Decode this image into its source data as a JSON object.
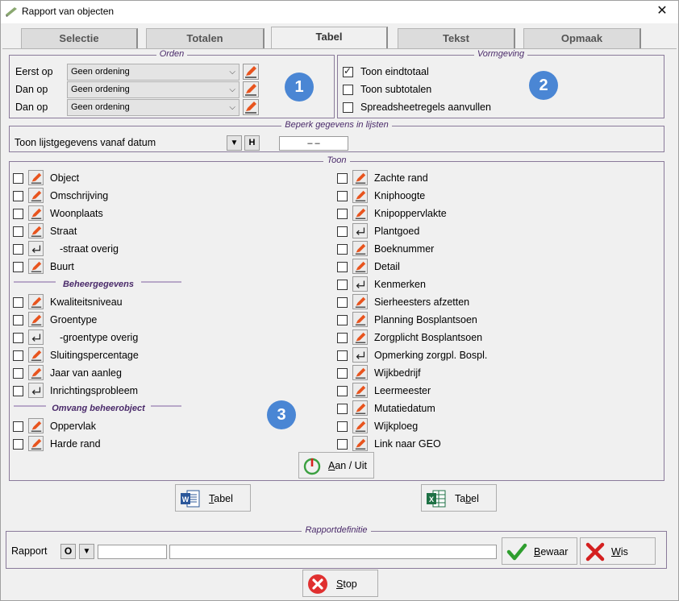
{
  "window": {
    "title": "Rapport van objecten",
    "close_label": "✕"
  },
  "tabs": [
    "Selectie",
    "Totalen",
    "Tabel",
    "Tekst",
    "Opmaak"
  ],
  "orden": {
    "legend": "Orden",
    "rows": [
      {
        "label": "Eerst op",
        "value": "Geen ordening"
      },
      {
        "label": "Dan op",
        "value": "Geen ordening"
      },
      {
        "label": "Dan op",
        "value": "Geen ordening"
      }
    ],
    "badge": "1"
  },
  "vormgeving": {
    "legend": "Vormgeving",
    "options": [
      {
        "label": "Toon eindtotaal",
        "checked": true
      },
      {
        "label": "Toon subtotalen",
        "checked": false
      },
      {
        "label": "Spreadsheetregels aanvullen",
        "checked": false
      }
    ],
    "badge": "2"
  },
  "beperk": {
    "legend": "Beperk gegevens in lijsten",
    "label": "Toon lijstgegevens vanaf datum",
    "h_button": "H",
    "date_value": "–   –"
  },
  "toon": {
    "legend": "Toon",
    "left_col": [
      {
        "label": "Object",
        "icon": "pencil-icon"
      },
      {
        "label": "Omschrijving",
        "icon": "pencil-icon"
      },
      {
        "label": "Woonplaats",
        "icon": "pencil-icon"
      },
      {
        "label": "Straat",
        "icon": "pencil-icon"
      },
      {
        "label": "-straat overig",
        "icon": "return-icon"
      },
      {
        "label": "Buurt",
        "icon": "pencil-icon"
      }
    ],
    "sub1": "Beheergegevens",
    "left_col2": [
      {
        "label": "Kwaliteitsniveau",
        "icon": "pencil-icon"
      },
      {
        "label": "Groentype",
        "icon": "pencil-icon"
      },
      {
        "label": "-groentype overig",
        "icon": "return-icon"
      },
      {
        "label": "Sluitingspercentage",
        "icon": "pencil-icon"
      },
      {
        "label": "Jaar van aanleg",
        "icon": "pencil-icon"
      },
      {
        "label": "Inrichtingsprobleem",
        "icon": "return-icon"
      }
    ],
    "sub2": "Omvang beheerobject",
    "left_col3": [
      {
        "label": "Oppervlak",
        "icon": "pencil-icon"
      },
      {
        "label": "Harde rand",
        "icon": "pencil-icon"
      }
    ],
    "right_col": [
      {
        "label": "Zachte rand",
        "icon": "pencil-icon"
      },
      {
        "label": "Kniphoogte",
        "icon": "pencil-icon"
      },
      {
        "label": "Knipoppervlakte",
        "icon": "pencil-icon"
      },
      {
        "label": "Plantgoed",
        "icon": "return-icon"
      },
      {
        "label": "Boeknummer",
        "icon": "pencil-icon"
      },
      {
        "label": "Detail",
        "icon": "pencil-icon"
      },
      {
        "label": "Kenmerken",
        "icon": "return-icon"
      },
      {
        "label": "Sierheesters afzetten",
        "icon": "pencil-icon"
      },
      {
        "label": "Planning Bosplantsoen",
        "icon": "pencil-icon"
      },
      {
        "label": "Zorgplicht Bosplantsoen",
        "icon": "pencil-icon"
      },
      {
        "label": "Opmerking zorgpl. Bospl.",
        "icon": "return-icon"
      },
      {
        "label": "Wijkbedrijf",
        "icon": "pencil-icon"
      },
      {
        "label": "Leermeester",
        "icon": "pencil-icon"
      },
      {
        "label": "Mutatiedatum",
        "icon": "pencil-icon"
      },
      {
        "label": "Wijkploeg",
        "icon": "pencil-icon"
      },
      {
        "label": "Link naar GEO",
        "icon": "pencil-icon"
      }
    ],
    "badge": "3",
    "toggle_label_a": "A",
    "toggle_label_rest": "an / Uit"
  },
  "export": {
    "word": {
      "u": "T",
      "rest": "abel"
    },
    "excel": {
      "pre": "Ta",
      "u": "b",
      "rest": "el"
    }
  },
  "rapport": {
    "legend": "Rapportdefinitie",
    "label": "Rapport",
    "o_button": "O",
    "short_value": "",
    "long_value": "",
    "save": {
      "u": "B",
      "rest": "ewaar"
    },
    "wis": {
      "u": "W",
      "rest": "is"
    }
  },
  "stop": {
    "u": "S",
    "rest": "top"
  },
  "colors": {
    "pencil": "#e8541e",
    "badge": "#4a86d4",
    "legend": "#4a2a6a"
  }
}
